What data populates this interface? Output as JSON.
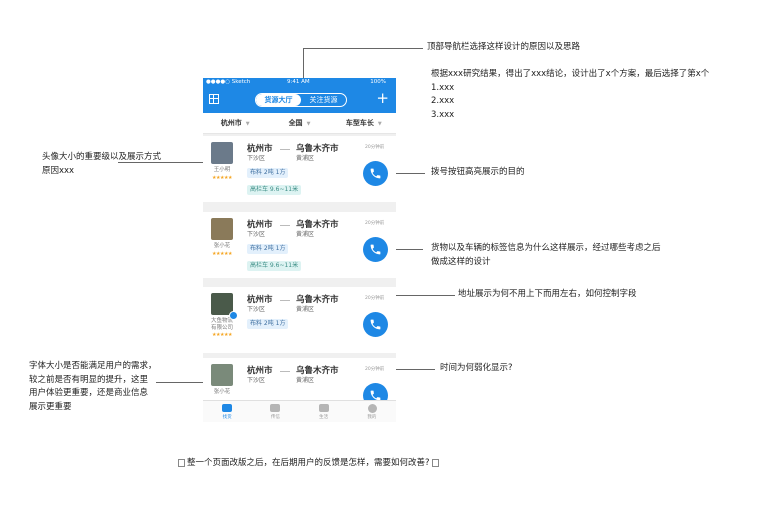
{
  "annotations": {
    "top_nav": "顶部导航栏选择这样设计的原因以及思路",
    "research": [
      "根据xxx研究结果，得出了xxx结论，设计出了x个方案，最后选择了第x个",
      "1.xxx",
      "2.xxx",
      "3.xxx"
    ],
    "avatar": [
      "头像大小的重要级以及展示方式",
      "原因xxx"
    ],
    "call_button": "拨号按钮高亮展示的目的",
    "tags": [
      "货物以及车辆的标签信息为什么这样展示，经过哪些考虑之后",
      "做成这样的设计"
    ],
    "address": "地址展示为何不用上下而用左右，如何控制字段",
    "time": "时间为何弱化显示?",
    "font": [
      "字体大小是否能满足用户的需求，",
      "较之前是否有明显的提升，这里",
      "用户体验更重要，还是商业信息",
      "展示更重要"
    ],
    "feedback": "整一个页面改版之后，在后期用户的反馈是怎样，需要如何改善?"
  },
  "phone": {
    "status": {
      "carrier": "●●●●○ Sketch",
      "time": "9:41 AM",
      "battery": "100%"
    },
    "nav": {
      "tab_active": "货源大厅",
      "tab_inactive": "关注货源",
      "plus": "+"
    },
    "filters": [
      "杭州市",
      "全国",
      "车型车长"
    ],
    "cards": [
      {
        "name": "王小明",
        "from_city": "杭州市",
        "from_district": "下沙区",
        "to_city": "乌鲁木齐市",
        "to_district": "黄浦区",
        "time": "20分钟前",
        "cargo": "布料 2吨 1方",
        "truck": "高栏车 9.6~11米",
        "stars": "★★★★★",
        "avatar_color": "#6b7a8a"
      },
      {
        "name": "张小花",
        "from_city": "杭州市",
        "from_district": "下沙区",
        "to_city": "乌鲁木齐市",
        "to_district": "黄浦区",
        "time": "20分钟前",
        "cargo": "布料 2吨 1方",
        "truck": "高栏车 9.6~11米",
        "stars": "★★★★★",
        "avatar_color": "#8a7a5a"
      },
      {
        "name": "大鱼物流\n有限公司",
        "from_city": "杭州市",
        "from_district": "下沙区",
        "to_city": "乌鲁木齐市",
        "to_district": "黄浦区",
        "time": "20分钟前",
        "cargo": "布料 2吨 1方",
        "truck": "",
        "stars": "★★★★★",
        "avatar_color": "#4a5a4a"
      },
      {
        "name": "张小花",
        "from_city": "杭州市",
        "from_district": "下沙区",
        "to_city": "乌鲁木齐市",
        "to_district": "黄浦区",
        "time": "20分钟前",
        "cargo": "",
        "truck": "",
        "stars": "",
        "avatar_color": "#7a8a7a"
      }
    ],
    "tabs": [
      "找货",
      "传信",
      "生活",
      "我的"
    ],
    "accent": "#1e88e5"
  }
}
